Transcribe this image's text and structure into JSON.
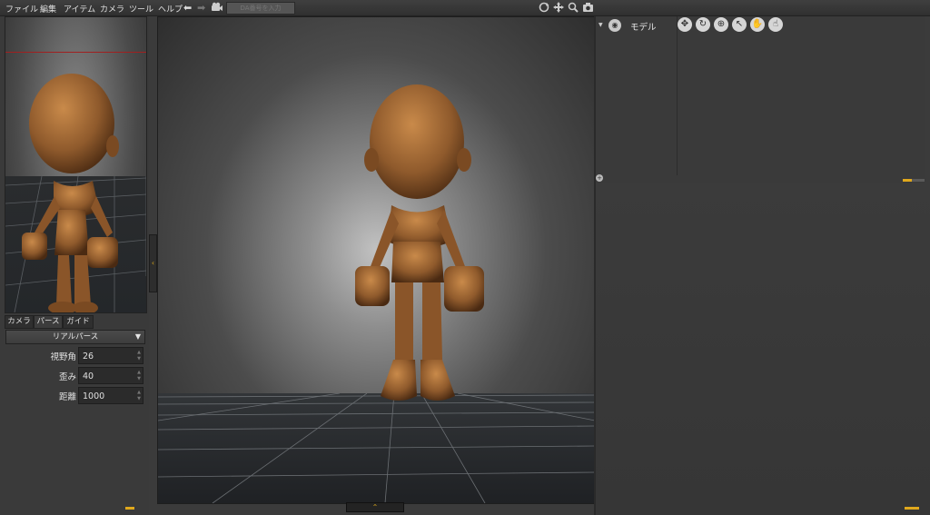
{
  "menu": {
    "items": [
      "ファイル",
      "編集",
      "アイテム",
      "カメラ",
      "ツール",
      "ヘルプ"
    ],
    "search_placeholder": "DA番号を入力"
  },
  "toolbar_left_icons": [
    "back-arrow-icon",
    "forward-arrow-icon",
    "camera-icon"
  ],
  "toolbar_right_icons": [
    "orbit-icon",
    "pan-icon",
    "zoom-icon",
    "render-icon"
  ],
  "left_panel": {
    "tabs": [
      "カメラ",
      "パース",
      "ガイド"
    ],
    "active_tab": "パース",
    "perspective_mode": "リアルパース",
    "properties": [
      {
        "label": "視野角",
        "value": "26"
      },
      {
        "label": "歪み",
        "value": "40"
      },
      {
        "label": "距離",
        "value": "1000"
      }
    ]
  },
  "right_panel": {
    "tree_item": "モデル",
    "tool_icons": [
      "move-tool-icon",
      "rotate-tool-icon",
      "zoom-tool-icon",
      "select-tool-icon",
      "hand-tool-icon",
      "finger-tool-icon"
    ]
  },
  "colors": {
    "accent": "#e0a81c",
    "figure_bronze": "#9a6532",
    "background": "#3b3b3b"
  }
}
